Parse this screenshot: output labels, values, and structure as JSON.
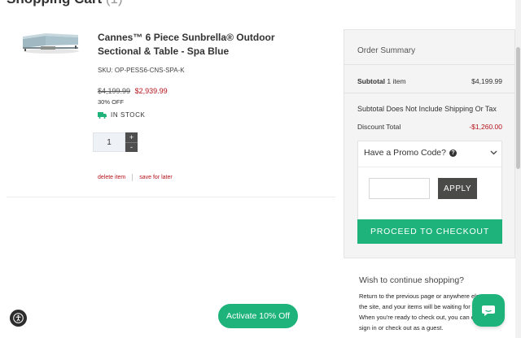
{
  "page": {
    "title": "Shopping Cart",
    "count": "(1)"
  },
  "item": {
    "name": "Cannes™ 6 Piece Sunbrella® Outdoor Sectional & Table - Spa Blue",
    "sku": "SKU: OP-PESS6-CNS-SPA-K",
    "old_price": "$4,199.99",
    "new_price": "$2,939.99",
    "discount": "30% OFF",
    "stock": "IN STOCK",
    "quantity": "1",
    "qty_plus": "+",
    "qty_minus": "-",
    "delete_label": "delete item",
    "save_label": "save for later",
    "image_icon": "sectional-sofa-image"
  },
  "summary": {
    "title": "Order Summary",
    "subtotal_label": "Subtotal",
    "subtotal_items": "1 item",
    "subtotal_value": "$4,199.99",
    "note": "Subtotal Does Not Include Shipping Or Tax",
    "discount_label": "Discount Total",
    "discount_value": "-$1,260.00",
    "promo_label": "Have a Promo Code?",
    "promo_help": "?",
    "promo_input_value": "",
    "apply_label": "APPLY",
    "checkout_label": "PROCEED TO CHECKOUT"
  },
  "continue": {
    "title": "Wish to continue shopping?",
    "text": "Return to the previous page or anywhere else on the site, and your items will be waiting for you. When you're ready to check out, you can either sign in or check out as a guest."
  },
  "widgets": {
    "activate_label": "Activate 10% Off",
    "accessibility_icon": "accessibility-icon",
    "chat_icon": "chat-icon"
  },
  "colors": {
    "accent": "#1db37b",
    "sale": "#b5121b",
    "dark_button": "#4a4a48"
  }
}
